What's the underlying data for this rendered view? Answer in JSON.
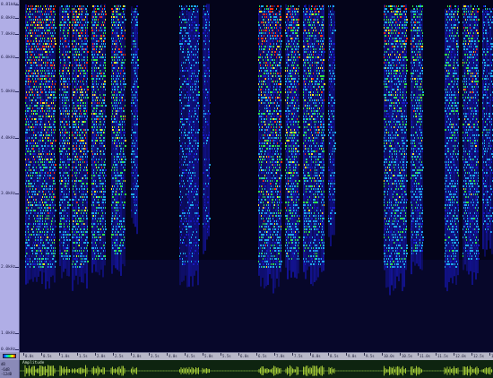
{
  "frequency_axis": {
    "labels": [
      "8.81kHz",
      "8.0kHz",
      "7.0kHz",
      "6.0kHz",
      "5.0kHz",
      "4.0kHz",
      "3.0kHz",
      "2.0kHz",
      "1.0kHz",
      "0.0kHz"
    ]
  },
  "time_ruler": {
    "labels": [
      "0.0s",
      "0.5s",
      "1.0s",
      "1.5s",
      "2.0s",
      "2.5s",
      "3.0s",
      "3.5s",
      "4.0s",
      "4.5s",
      "5.0s",
      "5.5s",
      "6.0s",
      "6.5s",
      "7.0s",
      "7.5s",
      "8.0s",
      "8.5s",
      "9.0s",
      "9.5s",
      "10.0s",
      "10.5s",
      "11.0s",
      "11.5s",
      "12.0s",
      "12.5s",
      "13.0s"
    ]
  },
  "waveform": {
    "title": "Amplitude",
    "scale_labels": [
      "dB",
      "-6dB",
      "-12dB"
    ]
  },
  "colors": {
    "background": "#04041a",
    "low": "#1818c0",
    "mid": "#1ca8e8",
    "high": "#30e040",
    "peak": "#ffe020",
    "max": "#ff3010",
    "wave": "#c8f040"
  },
  "colormap": [
    "blue",
    "cyan",
    "green",
    "yellow",
    "red"
  ]
}
